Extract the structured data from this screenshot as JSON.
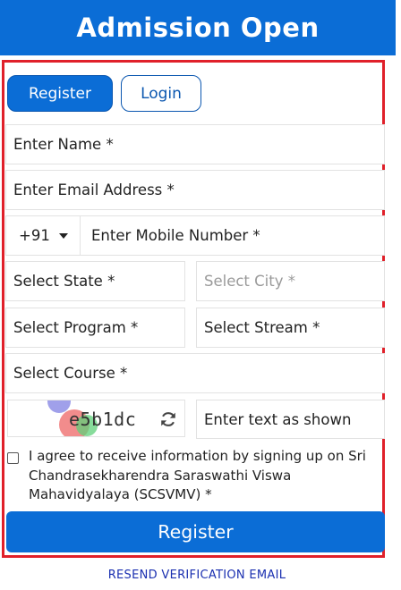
{
  "header": {
    "title": "Admission Open"
  },
  "tabs": [
    {
      "label": "Register",
      "active": true
    },
    {
      "label": "Login",
      "active": false
    }
  ],
  "form": {
    "name": "Enter Name *",
    "email": "Enter Email Address *",
    "country_code": "+91",
    "mobile": "Enter Mobile Number *",
    "state": "Select State *",
    "city": "Select City *",
    "program": "Select Program *",
    "stream": "Select Stream *",
    "course": "Select Course *",
    "captcha_code": "e5b1dc",
    "captcha_input": "Enter text as shown",
    "agree_text": "I agree to receive information by signing up on Sri Chandrasekharendra Saraswathi Viswa Mahavidyalaya (SCSVMV) *",
    "submit_label": "Register"
  },
  "footer": {
    "resend_label": "RESEND VERIFICATION EMAIL"
  },
  "colors": {
    "brand_blue": "#0b6dd6",
    "frame_red": "#e0202a",
    "link_blue": "#1a2fb0"
  }
}
